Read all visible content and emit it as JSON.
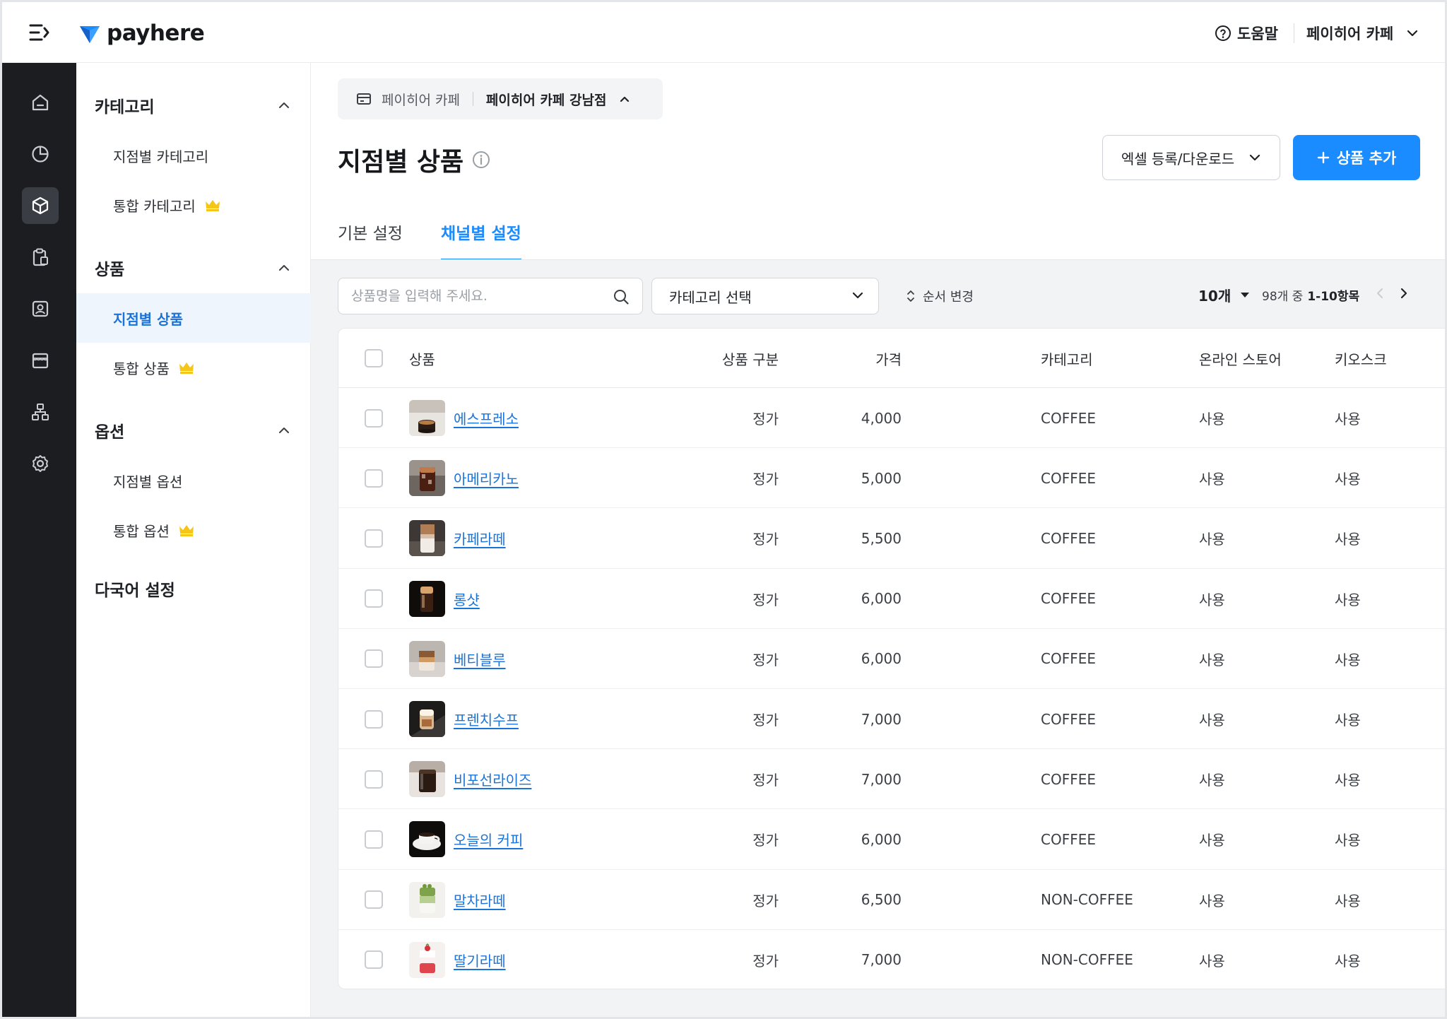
{
  "topbar": {
    "logo_text": "payhere",
    "help_label": "도움말",
    "store_name": "페이히어 카페"
  },
  "rail": {
    "icons": [
      "home-icon",
      "chart-pie-icon",
      "product-box-icon",
      "clipboard-icon",
      "contact-card-icon",
      "store-icon",
      "org-chart-icon",
      "gear-icon"
    ],
    "active": "product-box-icon"
  },
  "submenu": {
    "sections": [
      {
        "label": "카테고리",
        "items": [
          {
            "label": "지점별 카테고리",
            "premium": false
          },
          {
            "label": "통합 카테고리",
            "premium": true
          }
        ]
      },
      {
        "label": "상품",
        "items": [
          {
            "label": "지점별 상품",
            "premium": false,
            "active": true
          },
          {
            "label": "통합 상품",
            "premium": true
          }
        ]
      },
      {
        "label": "옵션",
        "items": [
          {
            "label": "지점별 옵션",
            "premium": false
          },
          {
            "label": "통합 옵션",
            "premium": true
          }
        ]
      },
      {
        "label": "다국어 설정",
        "items": []
      }
    ],
    "premium_color": "#f5c518"
  },
  "breadcrumb": {
    "store": "페이히어 카페",
    "branch": "페이히어 카페 강남점"
  },
  "page": {
    "title": "지점별 상품",
    "excel_label": "엑셀 등록/다운로드",
    "add_label": "상품 추가",
    "accent": "#1a8cff"
  },
  "tabs": [
    {
      "label": "기본 설정",
      "active": false
    },
    {
      "label": "채널별 설정",
      "active": true
    }
  ],
  "toolbar": {
    "search_placeholder": "상품명을 입력해 주세요.",
    "category_label": "카테고리 선택",
    "order_label": "순서 변경",
    "page_size": "10개",
    "range_prefix": "98개 중",
    "range_value": "1-10항목"
  },
  "table": {
    "columns": {
      "product": "상품",
      "type": "상품 구분",
      "price": "가격",
      "category": "카테고리",
      "online": "온라인 스토어",
      "kiosk": "키오스크"
    },
    "rows": [
      {
        "name": "에스프레소",
        "type": "정가",
        "price": "4,000",
        "category": "COFFEE",
        "online": "사용",
        "kiosk": "사용",
        "thumb": "espresso"
      },
      {
        "name": "아메리카노",
        "type": "정가",
        "price": "5,000",
        "category": "COFFEE",
        "online": "사용",
        "kiosk": "사용",
        "thumb": "americano"
      },
      {
        "name": "카페라떼",
        "type": "정가",
        "price": "5,500",
        "category": "COFFEE",
        "online": "사용",
        "kiosk": "사용",
        "thumb": "latte"
      },
      {
        "name": "롱샷",
        "type": "정가",
        "price": "6,000",
        "category": "COFFEE",
        "online": "사용",
        "kiosk": "사용",
        "thumb": "longshot"
      },
      {
        "name": "베티블루",
        "type": "정가",
        "price": "6,000",
        "category": "COFFEE",
        "online": "사용",
        "kiosk": "사용",
        "thumb": "bettyblue"
      },
      {
        "name": "프렌치수프",
        "type": "정가",
        "price": "7,000",
        "category": "COFFEE",
        "online": "사용",
        "kiosk": "사용",
        "thumb": "frenchsoup"
      },
      {
        "name": "비포선라이즈",
        "type": "정가",
        "price": "7,000",
        "category": "COFFEE",
        "online": "사용",
        "kiosk": "사용",
        "thumb": "beforesunrise"
      },
      {
        "name": "오늘의 커피",
        "type": "정가",
        "price": "6,000",
        "category": "COFFEE",
        "online": "사용",
        "kiosk": "사용",
        "thumb": "todaycoffee"
      },
      {
        "name": "말차라떼",
        "type": "정가",
        "price": "6,500",
        "category": "NON-COFFEE",
        "online": "사용",
        "kiosk": "사용",
        "thumb": "matcha"
      },
      {
        "name": "딸기라떼",
        "type": "정가",
        "price": "7,000",
        "category": "NON-COFFEE",
        "online": "사용",
        "kiosk": "사용",
        "thumb": "strawberry"
      }
    ]
  }
}
